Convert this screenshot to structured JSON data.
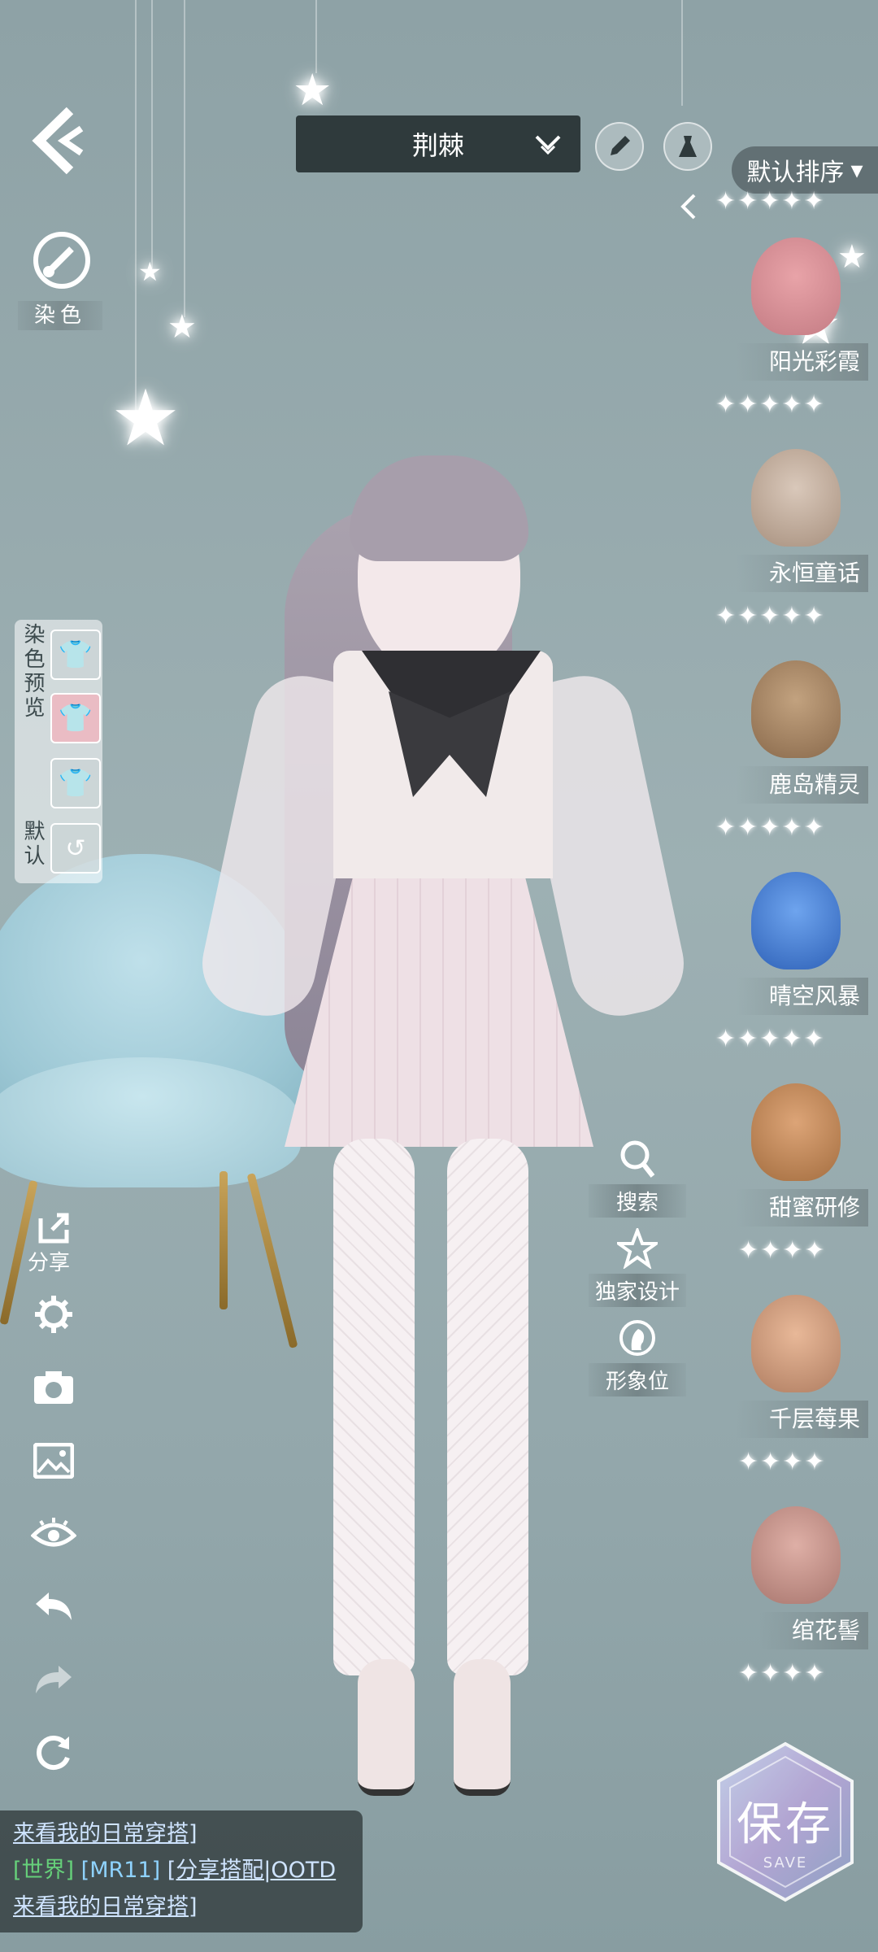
{
  "header": {
    "character_name": "荆棘",
    "sort_label": "默认排序"
  },
  "left": {
    "dye_label": "染色",
    "dye_preview_label": "染色预览",
    "default_label": "默认",
    "share_label": "分享"
  },
  "middle": {
    "search_label": "搜索",
    "exclusive_label": "独家设计",
    "image_slot_label": "形象位"
  },
  "hair_list": [
    {
      "name": "阳光彩霞",
      "stars": "✦✦✦✦✦",
      "color": "#e8a3a8"
    },
    {
      "name": "永恒童话",
      "stars": "✦✦✦✦✦",
      "color": "#c9b5a6"
    },
    {
      "name": "鹿岛精灵",
      "stars": "✦✦✦✦✦",
      "color": "#a8896a"
    },
    {
      "name": "晴空风暴",
      "stars": "✦✦✦✦✦",
      "color": "#4f86d6"
    },
    {
      "name": "甜蜜研修",
      "stars": "✦✦✦✦",
      "color": "#c8905c"
    },
    {
      "name": "千层莓果",
      "stars": "✦✦✦✦",
      "color": "#d7a283"
    },
    {
      "name": "绾花髻",
      "stars": "✦✦✦✦",
      "color": "#c99a92"
    }
  ],
  "save": {
    "label": "保存",
    "sub": "SAVE"
  },
  "chat": {
    "line1": "来看我的日常穿搭]",
    "channel": "[世界]",
    "user_tag": "[MR11]",
    "line2_msg": "[分享搭配|OOTD",
    "line3": "来看我的日常穿搭]"
  },
  "colors": {
    "background": "#9db0b3",
    "panel_dark": "#2f3a3c",
    "chat_channel": "#66d07a",
    "chat_tag": "#8fd3ff"
  }
}
